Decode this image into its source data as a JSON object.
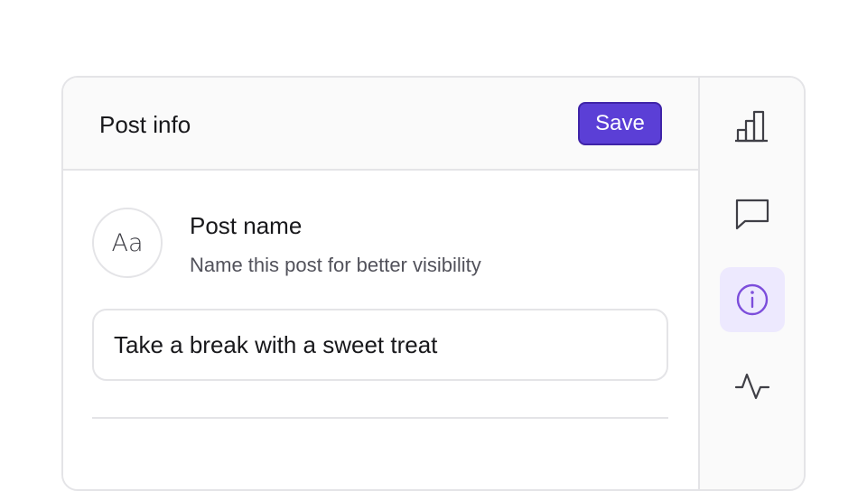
{
  "header": {
    "title": "Post info",
    "save_label": "Save"
  },
  "post_name_field": {
    "avatar_text": "Aa",
    "title": "Post name",
    "description": "Name this post for better visibility",
    "value": "Take a break with a sweet treat"
  },
  "side_rail": {
    "items": [
      {
        "icon": "bar-chart-icon",
        "active": false
      },
      {
        "icon": "message-icon",
        "active": false
      },
      {
        "icon": "info-icon",
        "active": true
      },
      {
        "icon": "activity-icon",
        "active": false
      }
    ]
  },
  "colors": {
    "accent": "#5b3fd6",
    "accent_border": "#3f24a8",
    "active_rail_bg": "#ede9fe",
    "active_icon": "#7c4ddb",
    "icon": "#3f3f46",
    "border": "#e4e4e7"
  }
}
